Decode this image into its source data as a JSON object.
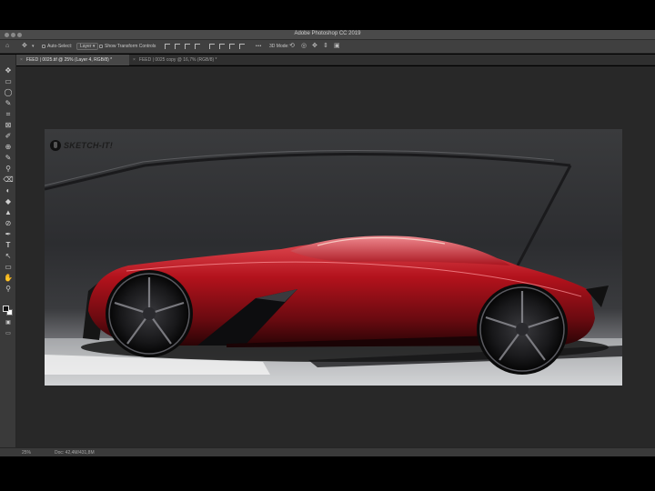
{
  "window": {
    "title": "Adobe Photoshop CC 2019"
  },
  "options_bar": {
    "auto_select_label": "Auto-Select:",
    "auto_select_value": "Layer",
    "transform_label": "Show Transform Controls",
    "mode_3d_label": "3D Mode:"
  },
  "tabs": [
    {
      "label": "FEED | 0025.tif @ 25% (Layer 4, RGB/8) *",
      "active": true
    },
    {
      "label": "FEED | 0025 copy @ 16,7% (RGB/8) *",
      "active": false
    }
  ],
  "canvas": {
    "brand_text": "SKETCH-IT!",
    "colors": {
      "body_red": "#b3121c",
      "background": "#2c2d30"
    }
  },
  "status_bar": {
    "zoom": "25%",
    "doc_info": "Doc: 42,4M/431,8M"
  },
  "icons": {
    "home": "⌂",
    "move": "✥",
    "menu_more": "•••",
    "tools": [
      "✥",
      "▭",
      "◯",
      "✎",
      "⌗",
      "⊠",
      "✐",
      "⊕",
      "✎",
      "⚲",
      "⌫",
      "◐",
      "◆",
      "▲",
      "⊘",
      "✒",
      "T",
      "↖",
      "▭",
      "✋",
      "⚲"
    ]
  }
}
